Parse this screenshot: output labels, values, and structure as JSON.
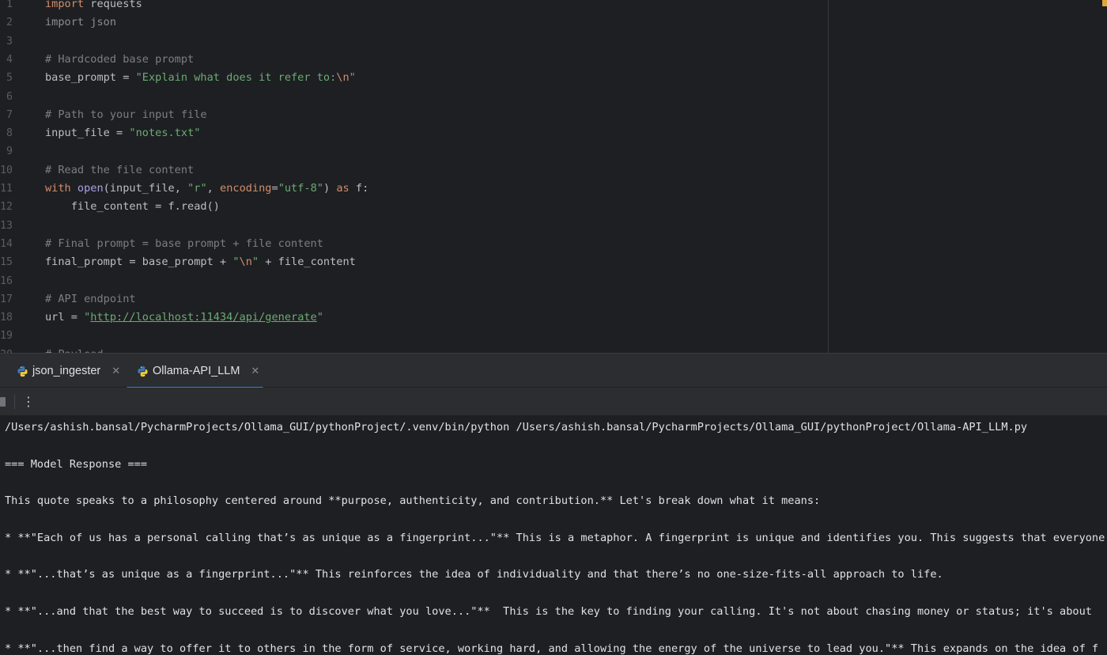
{
  "editor": {
    "lines": [
      {
        "n": "1",
        "segs": [
          {
            "t": "import",
            "c": "kw"
          },
          {
            "t": " requests",
            "c": ""
          }
        ]
      },
      {
        "n": "2",
        "segs": [
          {
            "t": "import json",
            "c": "dim"
          }
        ]
      },
      {
        "n": "3",
        "segs": []
      },
      {
        "n": "4",
        "segs": [
          {
            "t": "# Hardcoded base prompt",
            "c": "cm"
          }
        ]
      },
      {
        "n": "5",
        "segs": [
          {
            "t": "base_prompt = ",
            "c": ""
          },
          {
            "t": "\"Explain what does it refer to:",
            "c": "st"
          },
          {
            "t": "\\n",
            "c": "esc"
          },
          {
            "t": "\"",
            "c": "st"
          }
        ]
      },
      {
        "n": "6",
        "segs": []
      },
      {
        "n": "7",
        "segs": [
          {
            "t": "# Path to your input file",
            "c": "cm"
          }
        ]
      },
      {
        "n": "8",
        "segs": [
          {
            "t": "input_file = ",
            "c": ""
          },
          {
            "t": "\"notes.txt\"",
            "c": "st"
          }
        ]
      },
      {
        "n": "9",
        "segs": []
      },
      {
        "n": "10",
        "segs": [
          {
            "t": "# Read the file content",
            "c": "cm"
          }
        ]
      },
      {
        "n": "11",
        "segs": [
          {
            "t": "with ",
            "c": "kw"
          },
          {
            "t": "open",
            "c": "fn"
          },
          {
            "t": "(input_file, ",
            "c": ""
          },
          {
            "t": "\"r\"",
            "c": "st"
          },
          {
            "t": ", ",
            "c": ""
          },
          {
            "t": "encoding",
            "c": "kw"
          },
          {
            "t": "=",
            "c": ""
          },
          {
            "t": "\"utf-8\"",
            "c": "st"
          },
          {
            "t": ") ",
            "c": ""
          },
          {
            "t": "as",
            "c": "kw"
          },
          {
            "t": " f:",
            "c": ""
          }
        ]
      },
      {
        "n": "12",
        "segs": [
          {
            "t": "    file_content = f.read()",
            "c": ""
          }
        ]
      },
      {
        "n": "13",
        "segs": []
      },
      {
        "n": "14",
        "segs": [
          {
            "t": "# Final prompt = base prompt + file content",
            "c": "cm"
          }
        ]
      },
      {
        "n": "15",
        "segs": [
          {
            "t": "final_prompt = base_prompt + ",
            "c": ""
          },
          {
            "t": "\"",
            "c": "st"
          },
          {
            "t": "\\n",
            "c": "esc"
          },
          {
            "t": "\"",
            "c": "st"
          },
          {
            "t": " + file_content",
            "c": ""
          }
        ]
      },
      {
        "n": "16",
        "segs": []
      },
      {
        "n": "17",
        "segs": [
          {
            "t": "# API endpoint",
            "c": "cm"
          }
        ]
      },
      {
        "n": "18",
        "segs": [
          {
            "t": "url = ",
            "c": ""
          },
          {
            "t": "\"",
            "c": "st"
          },
          {
            "t": "http://localhost:11434/api/generate",
            "c": "url"
          },
          {
            "t": "\"",
            "c": "st"
          }
        ]
      },
      {
        "n": "19",
        "segs": []
      },
      {
        "n": "20",
        "segs": [
          {
            "t": "# Payload",
            "c": "cm"
          }
        ]
      }
    ]
  },
  "tool_window": {
    "tabs": [
      {
        "label": "json_ingester",
        "icon": "python-icon",
        "active": false
      },
      {
        "label": "Ollama-API_LLM",
        "icon": "python-icon",
        "active": true
      }
    ],
    "close_glyph": "✕",
    "more_glyph": "⋮"
  },
  "console": {
    "lines": [
      "/Users/ashish.bansal/PycharmProjects/Ollama_GUI/pythonProject/.venv/bin/python /Users/ashish.bansal/PycharmProjects/Ollama_GUI/pythonProject/Ollama-API_LLM.py",
      "",
      "=== Model Response ===",
      "",
      "This quote speaks to a philosophy centered around **purpose, authenticity, and contribution.** Let's break down what it means:",
      "",
      "* **\"Each of us has a personal calling that’s as unique as a fingerprint...\"** This is a metaphor. A fingerprint is unique and identifies you. This suggests that everyone",
      "",
      "* **\"...that’s as unique as a fingerprint...\"** This reinforces the idea of individuality and that there’s no one-size-fits-all approach to life.",
      "",
      "* **\"...and that the best way to succeed is to discover what you love...\"**  This is the key to finding your calling. It's not about chasing money or status; it's about",
      "",
      "* **\"...then find a way to offer it to others in the form of service, working hard, and allowing the energy of the universe to lead you.\"** This expands on the idea of f"
    ]
  },
  "colors": {
    "accent": "#3574f0",
    "editor_bg": "#1e1f22",
    "panel_bg": "#2b2d30"
  }
}
